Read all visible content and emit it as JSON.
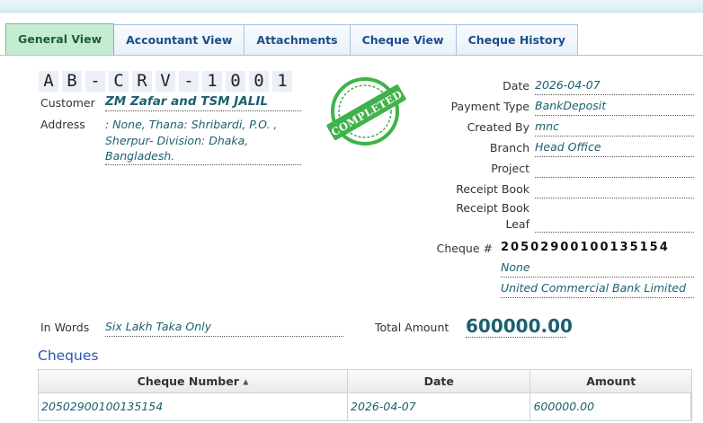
{
  "tabs": [
    {
      "label": "General View",
      "active": true
    },
    {
      "label": "Accountant View",
      "active": false
    },
    {
      "label": "Attachments",
      "active": false
    },
    {
      "label": "Cheque View",
      "active": false
    },
    {
      "label": "Cheque History",
      "active": false
    }
  ],
  "doc_number_chars": [
    "A",
    "B",
    "-",
    "C",
    "R",
    "V",
    "-",
    "1",
    "0",
    "0",
    "1"
  ],
  "left": {
    "customer_label": "Customer",
    "customer_value": "ZM Zafar and TSM JALIL",
    "address_label": "Address",
    "address_lines": [
      ": None, Thana: Shribardi, P.O. ,",
      "Sherpur- Division: Dhaka,",
      "Bangladesh."
    ]
  },
  "stamp": {
    "text": "COMPLETED",
    "color": "#3fb34a"
  },
  "right": {
    "date_label": "Date",
    "date_value": "2026-04-07",
    "payment_type_label": "Payment Type",
    "payment_type_value": "BankDeposit",
    "created_by_label": "Created By",
    "created_by_value": "mnc",
    "branch_label": "Branch",
    "branch_value": "Head Office",
    "project_label": "Project",
    "project_value": "",
    "receipt_book_label": "Receipt Book",
    "receipt_book_value": "",
    "receipt_leaf_label_1": "Receipt Book",
    "receipt_leaf_label_2": "Leaf",
    "receipt_leaf_value": "",
    "cheque_label": "Cheque #",
    "cheque_number": "20502900100135154",
    "cheque_line2": "None",
    "cheque_bank": "United Commercial Bank Limited"
  },
  "summary": {
    "in_words_label": "In Words",
    "in_words_value": "Six Lakh Taka Only",
    "total_label": "Total Amount",
    "total_value": "600000.00"
  },
  "cheques": {
    "section_title": "Cheques",
    "columns": [
      "Cheque Number",
      "Date",
      "Amount"
    ],
    "rows": [
      [
        "20502900100135154",
        "2026-04-07",
        "600000.00"
      ]
    ]
  },
  "colors": {
    "accent": "#1c6070",
    "active_tab": "#c4ecd2",
    "link": "#2a55a8"
  }
}
